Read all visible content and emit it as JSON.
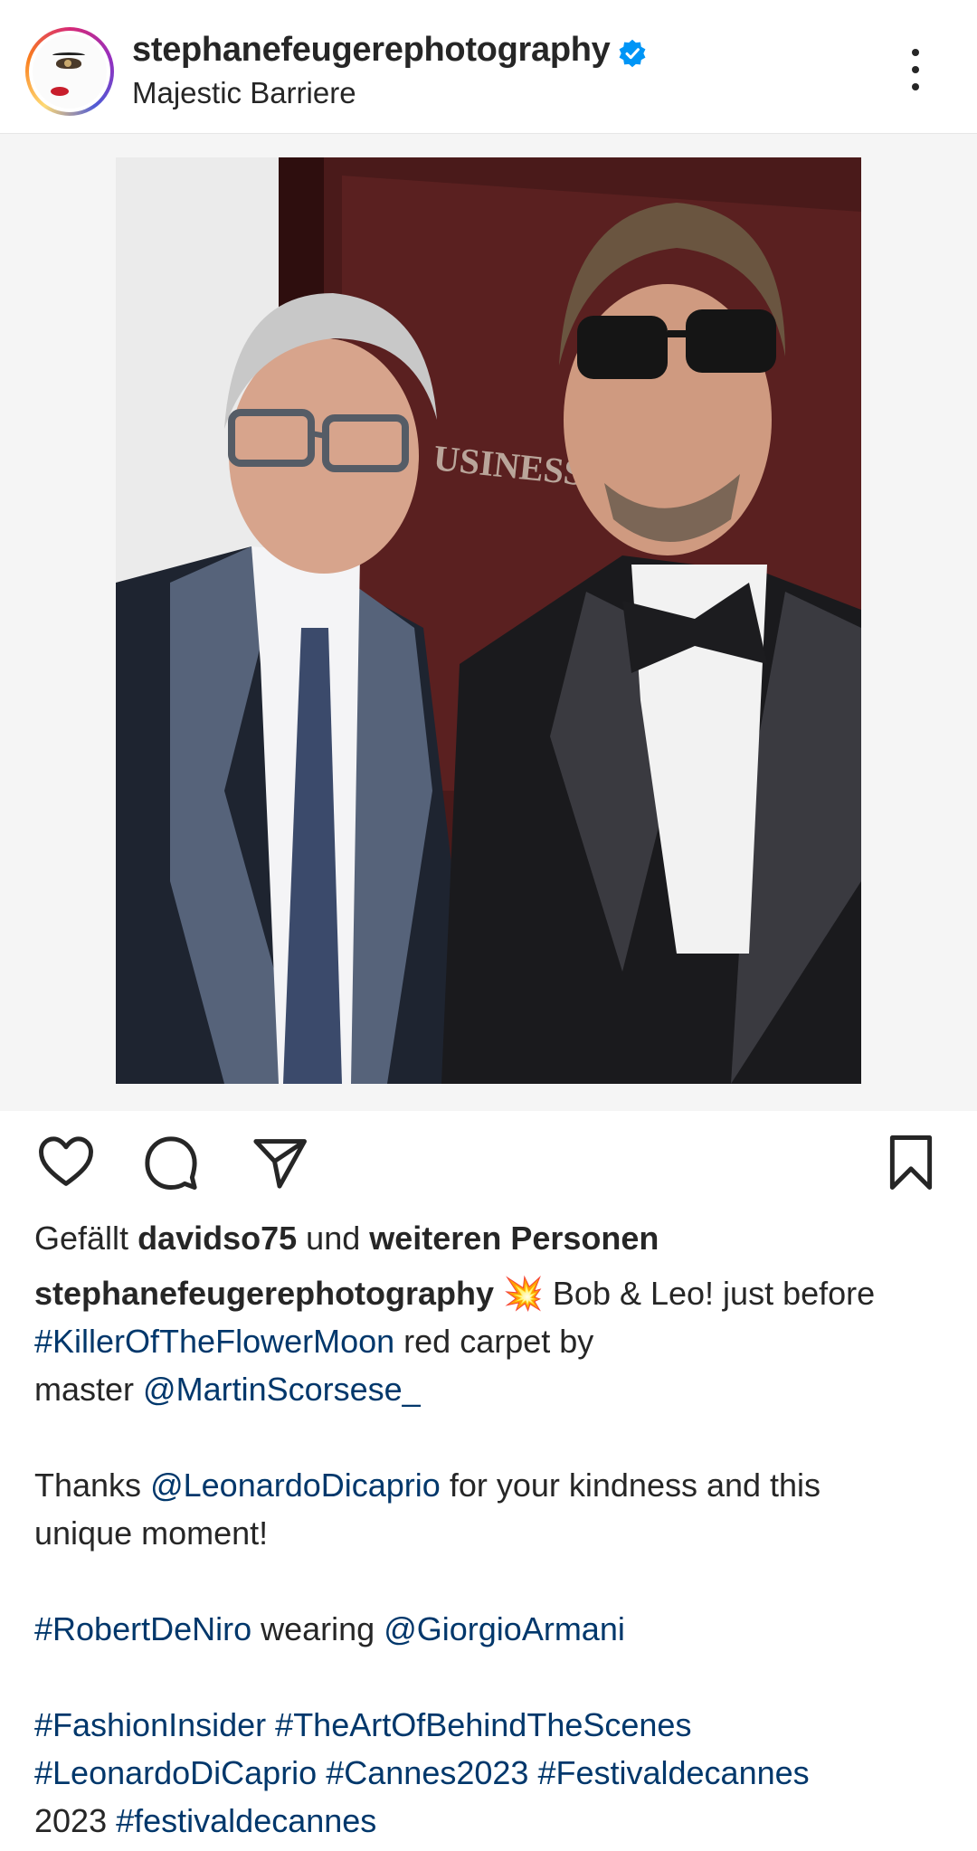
{
  "header": {
    "username": "stephanefeugerephotography",
    "location": "Majestic Barriere",
    "verified_icon": "verified-badge-icon",
    "more_icon": "more-options-icon"
  },
  "post": {
    "image_text": "USINESS"
  },
  "actions": {
    "like_icon": "heart-icon",
    "comment_icon": "comment-icon",
    "share_icon": "send-icon",
    "save_icon": "bookmark-icon"
  },
  "likes": {
    "prefix": "Gefällt",
    "user": "davidso75",
    "middle": "und",
    "rest": "weiteren Personen"
  },
  "caption": {
    "author": "stephanefeugerephotography",
    "emoji": "💥",
    "l1_text": "Bob & Leo! just before",
    "l2_tag": "#KillerOfTheFlowerMoon",
    "l2_text": "red carpet by",
    "l3_text": "master",
    "l3_mention": "@MartinScorsese_",
    "l4_text1": "Thanks",
    "l4_mention": "@LeonardoDicaprio",
    "l4_text2": "for your kindness and this",
    "l5_text": "unique moment!",
    "l6_tag": "#RobertDeNiro",
    "l6_text": "wearing",
    "l6_mention": "@GiorgioArmani",
    "l7_tag1": "#FashionInsider",
    "l7_tag2": "#TheArtOfBehindTheScenes",
    "l8_tag1": "#LeonardoDiCaprio",
    "l8_tag2": "#Cannes2023",
    "l8_tag3": "#Festivaldecannes",
    "l9_text": "2023",
    "l9_tag": "#festivaldecannes"
  },
  "colors": {
    "link": "#00376b",
    "verified": "#0095f6",
    "text": "#262626"
  }
}
